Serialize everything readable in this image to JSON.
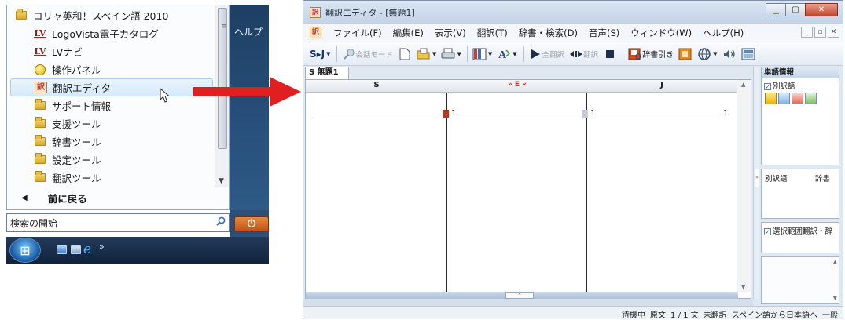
{
  "start_menu": {
    "items": [
      {
        "label": "コリャ英和！スペイン語 2010",
        "icon": "folder-icon",
        "indent": false
      },
      {
        "label": "LogoVista電子カタログ",
        "icon": "logovista-icon",
        "indent": true
      },
      {
        "label": "LVナビ",
        "icon": "logovista-icon",
        "indent": true
      },
      {
        "label": "操作パネル",
        "icon": "control-panel-icon",
        "indent": true
      },
      {
        "label": "翻訳エディタ",
        "icon": "translation-editor-icon",
        "indent": true,
        "highlighted": true
      },
      {
        "label": "サポート情報",
        "icon": "folder-icon",
        "indent": true
      },
      {
        "label": "支援ツール",
        "icon": "folder-icon",
        "indent": true
      },
      {
        "label": "辞書ツール",
        "icon": "folder-icon",
        "indent": true
      },
      {
        "label": "設定ツール",
        "icon": "folder-icon",
        "indent": true
      },
      {
        "label": "翻訳ツール",
        "icon": "folder-icon",
        "indent": true
      }
    ],
    "back_label": "前に戻る",
    "right_help": "ヘルプ",
    "search_placeholder": "検索の開始",
    "power_symbol": "⏻",
    "taskbar_more": "»"
  },
  "editor_window": {
    "title": "翻訳エディタ - [無題1]",
    "menu": [
      "ファイル(F)",
      "編集(E)",
      "表示(V)",
      "翻訳(T)",
      "辞書・検索(D)",
      "音声(S)",
      "ウィンドウ(W)",
      "ヘルプ(H)"
    ],
    "toolbar": {
      "sj_label": "S▸J",
      "speech_mode_label": "会話モード",
      "translate_all_label": "全翻訳",
      "translate_label": "翻訳",
      "dict_lookup_label": "辞書引き"
    },
    "doc_tab": "S 無題1",
    "columns": {
      "s": "S",
      "e": "» E «",
      "j": "J"
    },
    "row_numbers": {
      "s": "1",
      "e": "1",
      "j": "1"
    },
    "side": {
      "word_info_title": "単語情報",
      "alt_translation_check": "別訳語",
      "alt_translation_label": "別訳語",
      "dictionary_label": "辞書",
      "selection_check": "選択範囲翻訳・辞"
    },
    "status": [
      "待機中",
      "原文",
      "1 / 1 文",
      "未翻訳",
      "スペイン語から日本語へ",
      "一般"
    ]
  },
  "colors": {
    "arrow": "#e02020",
    "highlight": "#d6e9fb",
    "title_bar": "#c3d4e7"
  }
}
